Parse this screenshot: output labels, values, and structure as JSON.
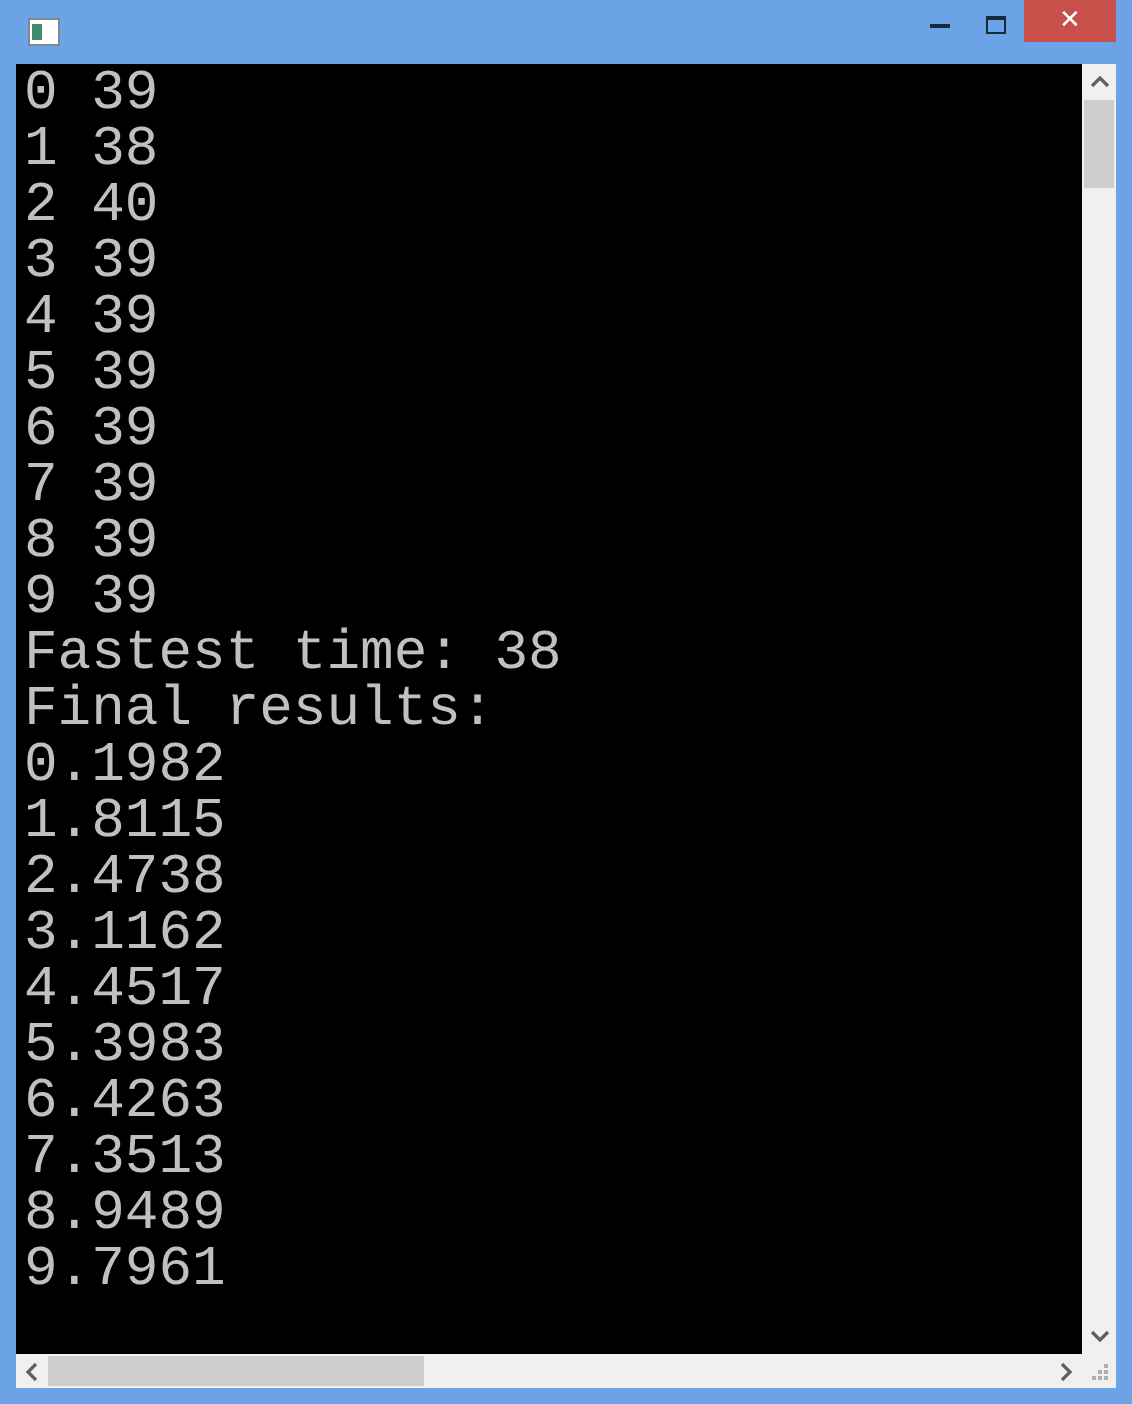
{
  "window": {
    "close_label": "✕"
  },
  "console": {
    "lines": [
      "0 39",
      "1 38",
      "2 40",
      "3 39",
      "4 39",
      "5 39",
      "6 39",
      "7 39",
      "8 39",
      "9 39",
      "Fastest time: 38",
      "Final results:",
      "0.1982",
      "1.8115",
      "2.4738",
      "3.1162",
      "4.4517",
      "5.3983",
      "6.4263",
      "7.3513",
      "8.9489",
      "9.7961"
    ]
  }
}
